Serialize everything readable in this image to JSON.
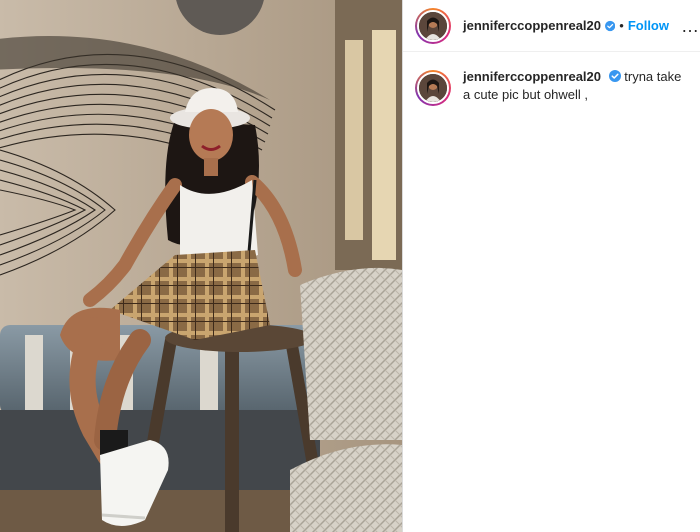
{
  "post": {
    "username": "jenniferccoppenreal20",
    "follow_label": "Follow",
    "separator": "•",
    "more_label": "…",
    "caption": "tryna take a cute pic but ohwell ,"
  },
  "icons": {
    "verified": "verified-badge-icon",
    "more": "more-options-icon"
  },
  "colors": {
    "accent": "#0095f6",
    "verified": "#3897f0"
  }
}
